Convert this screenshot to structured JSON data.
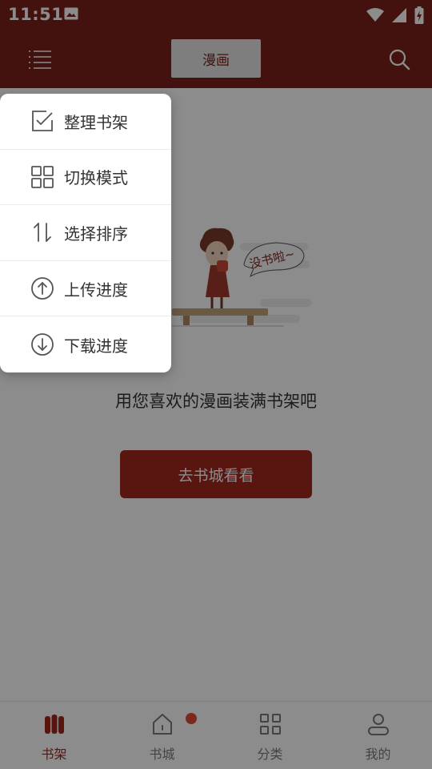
{
  "status_bar": {
    "time": "11:51"
  },
  "app_bar": {
    "title": "漫画"
  },
  "empty_state": {
    "bubble_text": "没书啦~",
    "message": "用您喜欢的漫画装满书架吧",
    "button_label": "去书城看看"
  },
  "popup_menu": {
    "items": [
      {
        "label": "整理书架",
        "icon": "checkbox-edit-icon"
      },
      {
        "label": "切换模式",
        "icon": "grid-icon"
      },
      {
        "label": "选择排序",
        "icon": "sort-icon"
      },
      {
        "label": "上传进度",
        "icon": "upload-icon"
      },
      {
        "label": "下载进度",
        "icon": "download-icon"
      }
    ]
  },
  "bottom_nav": {
    "items": [
      {
        "label": "书架",
        "icon": "bookshelf-icon",
        "active": true
      },
      {
        "label": "书城",
        "icon": "home-icon",
        "active": false,
        "badge": true
      },
      {
        "label": "分类",
        "icon": "category-grid-icon",
        "active": false
      },
      {
        "label": "我的",
        "icon": "user-icon",
        "active": false
      }
    ]
  },
  "colors": {
    "brand": "#7d211a",
    "button": "#a3281f",
    "badge": "#e04a3a"
  }
}
